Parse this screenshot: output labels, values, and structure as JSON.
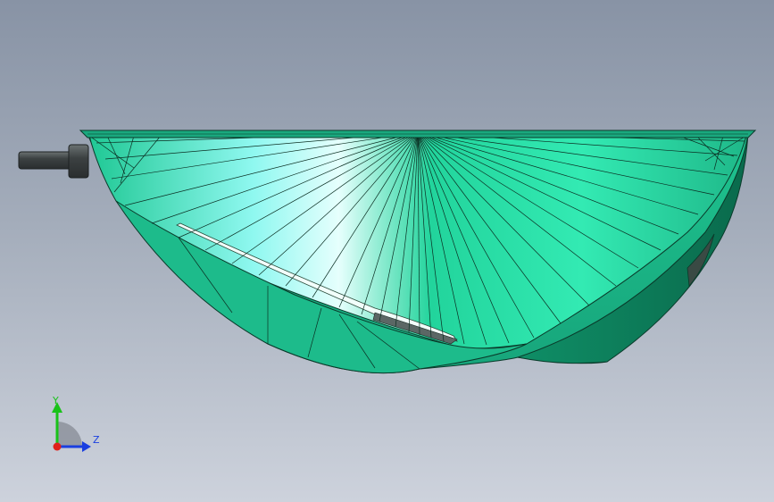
{
  "viewport": {
    "background_top": "#8893a5",
    "background_bottom": "#cdd2dc"
  },
  "model": {
    "icon": "lamp-reflector-model",
    "surface_color": "#1fb889",
    "highlight_color": "#3ff0c0",
    "edge_color": "#0a3a2a",
    "shaft_color": "#4a4f50"
  },
  "triad": {
    "y_label": "Y",
    "z_label": "Z",
    "y_color": "#19c219",
    "z_color": "#1a3fe0",
    "x_color": "#e0201a"
  }
}
